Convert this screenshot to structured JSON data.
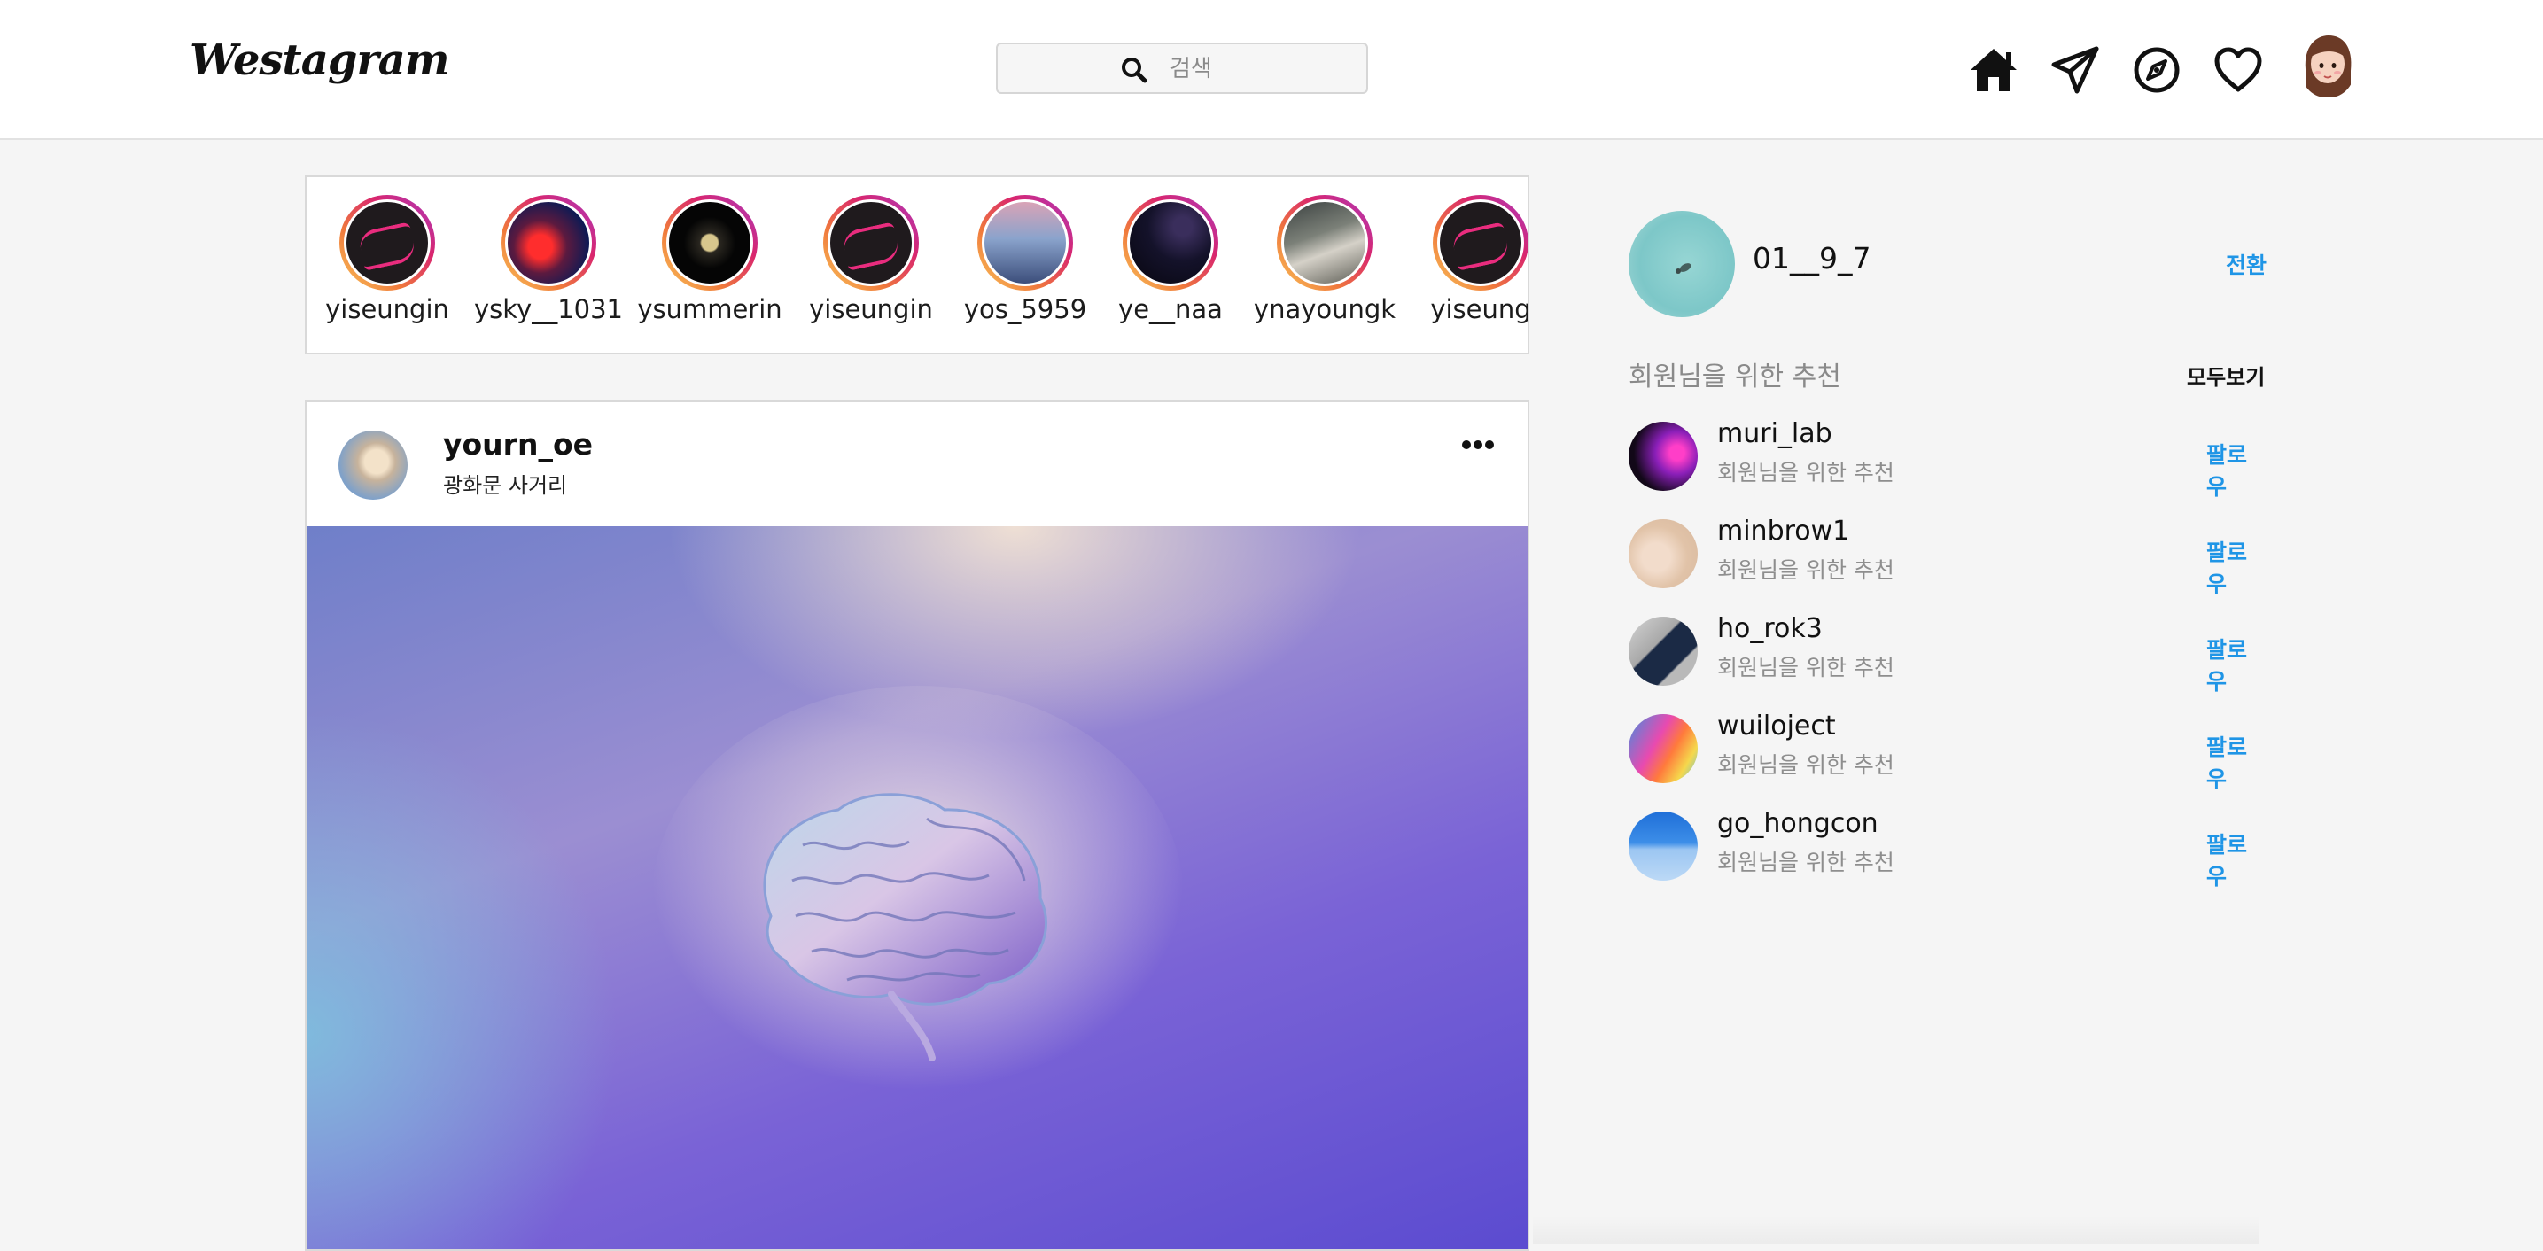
{
  "header": {
    "logo": "Westagram",
    "search": {
      "placeholder": "검색"
    },
    "icons": [
      "home-icon",
      "send-icon",
      "explore-icon",
      "heart-icon",
      "profile-avatar"
    ]
  },
  "stories": [
    {
      "username": "yiseungin"
    },
    {
      "username": "ysky__1031"
    },
    {
      "username": "ysummerin"
    },
    {
      "username": "yiseungin"
    },
    {
      "username": "yos_5959"
    },
    {
      "username": "ye__naa"
    },
    {
      "username": "ynayoungk"
    },
    {
      "username": "yiseung"
    }
  ],
  "post": {
    "username": "yourn_oe",
    "location": "광화문 사거리"
  },
  "sidebar": {
    "me": {
      "username": "01__9_7",
      "switch_label": "전환"
    },
    "recommend_title": "회원님을 위한 추천",
    "see_all_label": "모두보기",
    "suggestions": [
      {
        "username": "muri_lab",
        "subtitle": "회원님을 위한 추천",
        "follow_label": "팔로우"
      },
      {
        "username": "minbrow1",
        "subtitle": "회원님을 위한 추천",
        "follow_label": "팔로우"
      },
      {
        "username": "ho_rok3",
        "subtitle": "회원님을 위한 추천",
        "follow_label": "팔로우"
      },
      {
        "username": "wuiloject",
        "subtitle": "회원님을 위한 추천",
        "follow_label": "팔로우"
      },
      {
        "username": "go_hongcon",
        "subtitle": "회원님을 위한 추천",
        "follow_label": "팔로우"
      }
    ]
  },
  "colors": {
    "accent": "#1f95e6",
    "story_ring": "#d9266e",
    "muted_text": "#8e8e8e"
  }
}
